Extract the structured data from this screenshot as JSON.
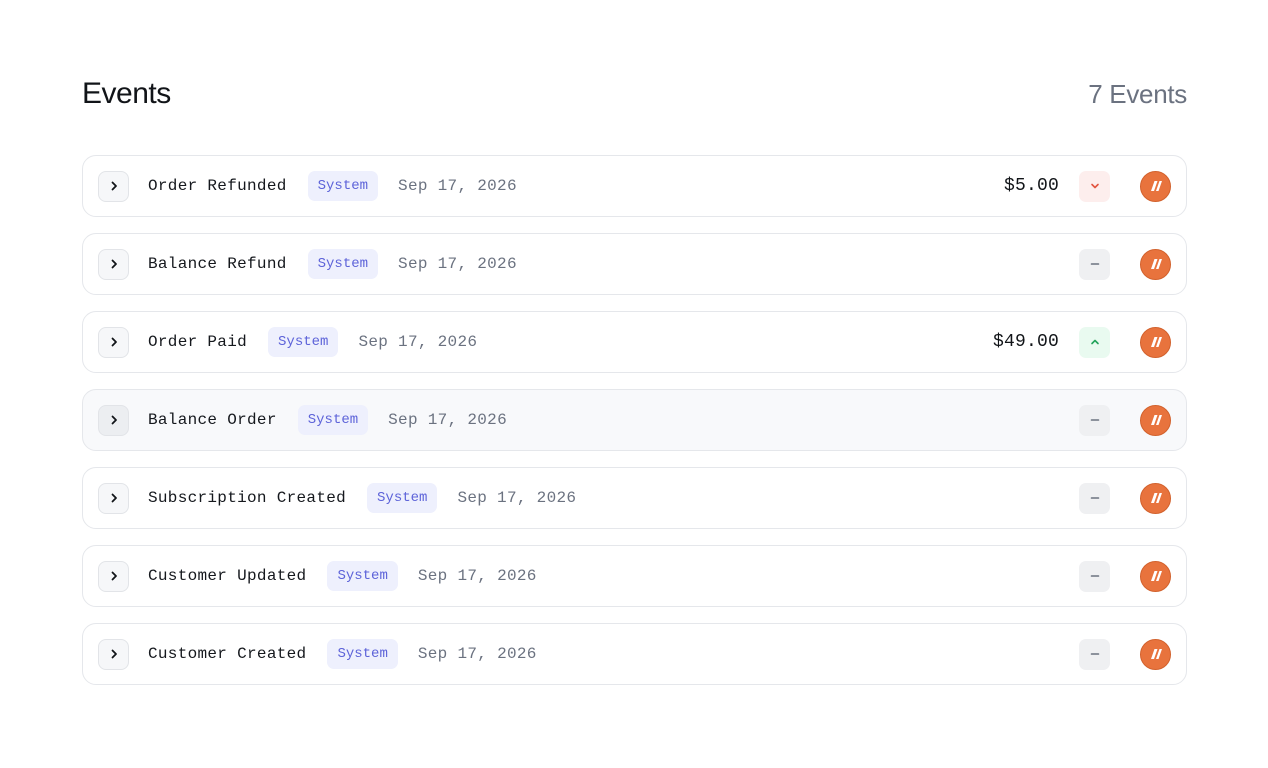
{
  "header": {
    "title": "Events",
    "count": "7 Events"
  },
  "events": [
    {
      "name": "Order Refunded",
      "badge": "System",
      "date": "Sep 17, 2026",
      "amount": "$5.00",
      "delta": "down"
    },
    {
      "name": "Balance Refund",
      "badge": "System",
      "date": "Sep 17, 2026",
      "amount": "",
      "delta": "none"
    },
    {
      "name": "Order Paid",
      "badge": "System",
      "date": "Sep 17, 2026",
      "amount": "$49.00",
      "delta": "up"
    },
    {
      "name": "Balance Order",
      "badge": "System",
      "date": "Sep 17, 2026",
      "amount": "",
      "delta": "none"
    },
    {
      "name": "Subscription Created",
      "badge": "System",
      "date": "Sep 17, 2026",
      "amount": "",
      "delta": "none"
    },
    {
      "name": "Customer Updated",
      "badge": "System",
      "date": "Sep 17, 2026",
      "amount": "",
      "delta": "none"
    },
    {
      "name": "Customer Created",
      "badge": "System",
      "date": "Sep 17, 2026",
      "amount": "",
      "delta": "none"
    }
  ],
  "icons": {
    "expand": "chevron-right-icon",
    "down": "chevron-down-icon",
    "up": "chevron-up-icon",
    "none": "minus-icon",
    "avatar": "org-logo-icon"
  },
  "colors": {
    "badge_bg": "#eef0fd",
    "badge_text": "#5d63d9",
    "down": "#e2543f",
    "up": "#22a35a",
    "avatar": "#e8733d"
  }
}
